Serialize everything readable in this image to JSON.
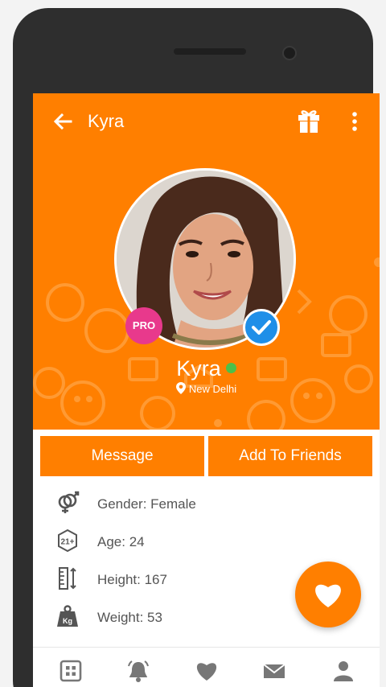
{
  "header": {
    "title": "Kyra",
    "back_icon": "arrow-left-icon",
    "gift_icon": "gift-icon",
    "more_icon": "more-vertical-icon"
  },
  "profile": {
    "name": "Kyra",
    "online": true,
    "location": "New Delhi",
    "pro_badge": "PRO",
    "verified": true
  },
  "actions": {
    "message_label": "Message",
    "add_friends_label": "Add To Friends"
  },
  "info": [
    {
      "icon": "gender-icon",
      "label": "Gender: Female"
    },
    {
      "icon": "age-21-plus-icon",
      "label": "Age: 24"
    },
    {
      "icon": "height-ruler-icon",
      "label": "Height: 167"
    },
    {
      "icon": "weight-kg-icon",
      "label": "Weight: 53"
    }
  ],
  "fab": {
    "icon": "heart-icon"
  },
  "bottom_nav": [
    {
      "icon": "grid-icon"
    },
    {
      "icon": "notification-bell-icon"
    },
    {
      "icon": "heart-icon"
    },
    {
      "icon": "mail-icon"
    },
    {
      "icon": "profile-person-icon"
    }
  ],
  "colors": {
    "accent": "#ff7f00",
    "pro": "#e8398c",
    "verified": "#1f8fe8",
    "online": "#4cc04a"
  }
}
